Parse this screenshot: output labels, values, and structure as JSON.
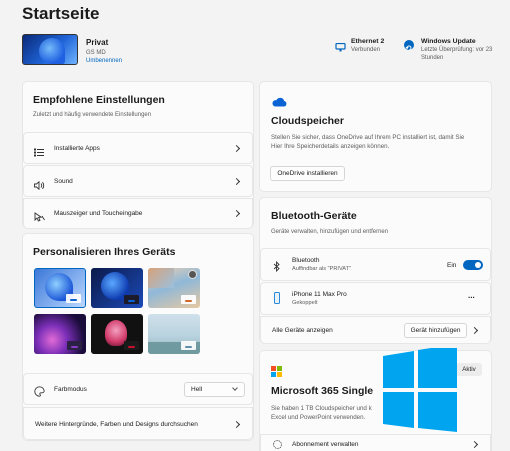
{
  "page": {
    "title": "Startseite"
  },
  "profile": {
    "name": "Privat",
    "device": "GS MD",
    "rename": "Umbenennen"
  },
  "status": {
    "ethernet": {
      "title": "Ethernet 2",
      "subtitle": "Verbunden"
    },
    "update": {
      "title": "Windows Update",
      "subtitle_line1": "Letzte Überprüfung: vor 23",
      "subtitle_line2": "Stunden"
    }
  },
  "recommended": {
    "title": "Empfohlene Einstellungen",
    "subtitle": "Zuletzt und häufig verwendete Einstellungen",
    "items": [
      {
        "label": "Installierte Apps",
        "icon": "apps-list-icon"
      },
      {
        "label": "Sound",
        "icon": "speaker-icon"
      },
      {
        "label": "Mauszeiger und Toucheingabe",
        "icon": "mouse-pointer-icon"
      }
    ]
  },
  "personalize": {
    "title": "Personalisieren Ihres Geräts",
    "color_mode_label": "Farbmodus",
    "color_mode_value": "Hell",
    "more_link": "Weitere Hintergründe, Farben und Designs durchsuchen"
  },
  "cloud": {
    "title": "Cloudspeicher",
    "text_line1": "Stellen Sie sicher, dass OneDrive auf Ihrem PC installiert ist, damit Sie",
    "text_line2": "Hier Ihre Speicherdetails anzeigen können.",
    "button": "OneDrive installieren"
  },
  "bluetooth": {
    "title": "Bluetooth-Geräte",
    "subtitle": "Geräte verwalten, hinzufügen und entfernen",
    "toggle_label": "Bluetooth",
    "toggle_sub": "Auffindbar als \"PRIVAT\"",
    "toggle_state": "Ein",
    "device_name": "iPhone 11 Max Pro",
    "device_status": "Gekoppelt",
    "more": "...",
    "show_all": "Alle Geräte anzeigen",
    "add_device": "Gerät hinzufügen"
  },
  "m365": {
    "title": "Microsoft 365 Single",
    "badge": "Aktiv",
    "text_line1": "Sie haben 1 TB Cloudspeicher und k",
    "text_line2": "Excel und PowerPoint verwenden.",
    "manage": "Abonnement verwalten"
  },
  "colors": {
    "accent": "#0067c0",
    "windows_logo": "#00a4ef"
  }
}
